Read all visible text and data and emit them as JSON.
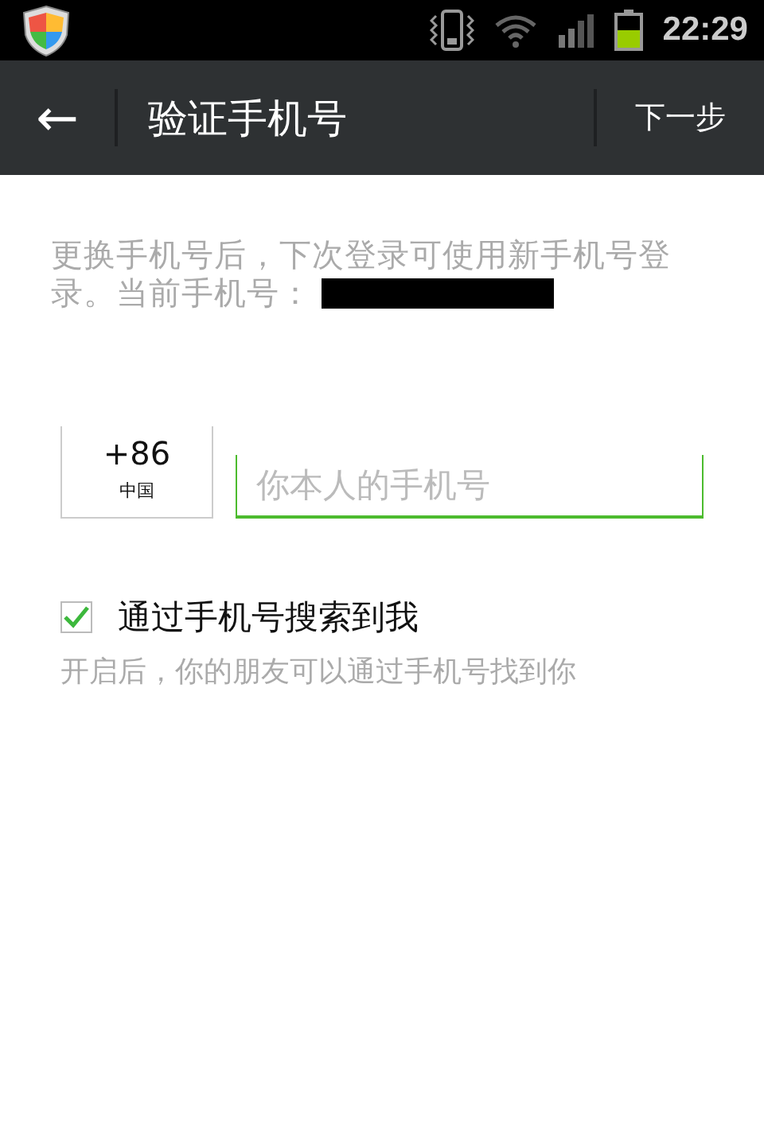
{
  "status_bar": {
    "time": "22:29"
  },
  "toolbar": {
    "back_icon": "←",
    "title": "验证手机号",
    "next": "下一步"
  },
  "intro": {
    "lines": [
      "更换手机号后，下次登录可使用新手机号登",
      "录。当前手机号："
    ]
  },
  "phone": {
    "country_code": "+86",
    "country": "中国",
    "placeholder": "你本人的手机号"
  },
  "search_option": {
    "label": "通过手机号搜索到我",
    "checked": true,
    "hint": "开启后，你的朋友可以通过手机号找到你"
  }
}
